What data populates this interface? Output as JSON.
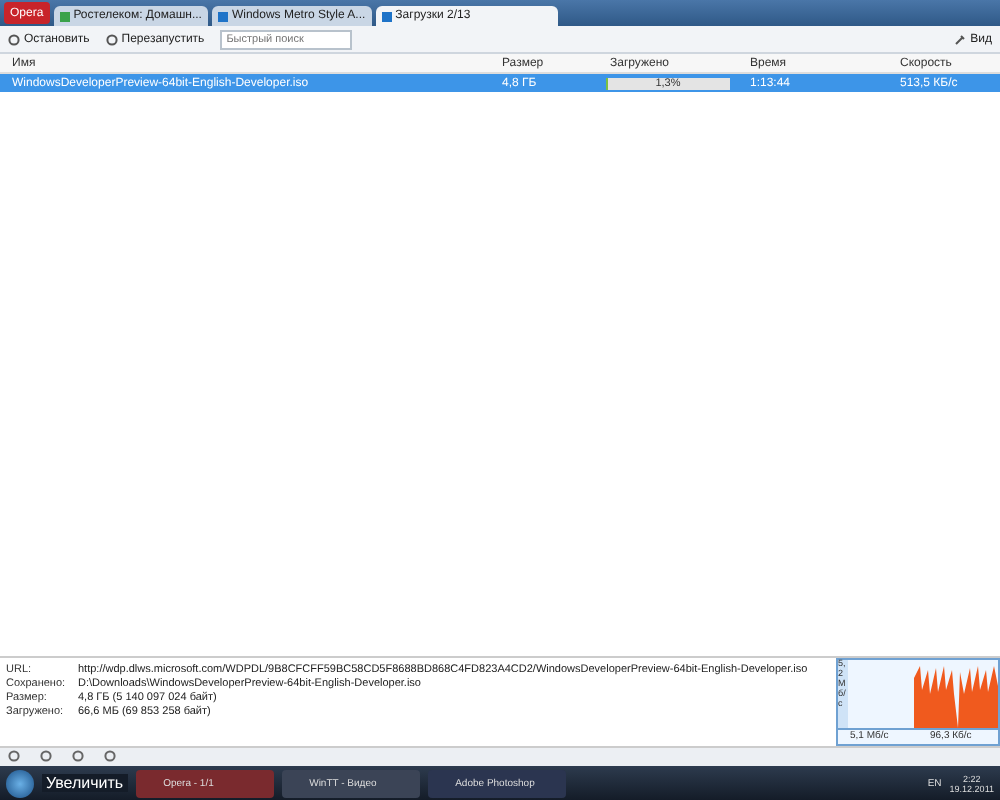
{
  "menu_button": {
    "label": "Opera"
  },
  "tabs": [
    {
      "label": "Ростелеком: Домашн...",
      "selected": false
    },
    {
      "label": "Windows Metro Style A...",
      "selected": false
    },
    {
      "label": "Загрузки 2/13",
      "selected": true
    }
  ],
  "toolbar": {
    "buttons": [
      "Остановить",
      "Перезапустить"
    ],
    "search": {
      "placeholder": "Быстрый поиск"
    },
    "view_button": "Вид"
  },
  "table": {
    "columns": [
      "Имя",
      "Размер",
      "Загружено",
      "Время",
      "Скорость"
    ],
    "rows": [
      {
        "name": "WindowsDeveloperPreview-64bit-English-Developer.iso",
        "size": "4,8 ГБ",
        "level": 0.013,
        "progress": "1,3%",
        "time": "1:13:44",
        "speed": "513,5 КБ/с",
        "selected": true
      }
    ]
  },
  "details": [
    {
      "label": "URL:",
      "value": "http://wdp.dlws.microsoft.com/WDPDL/9B8CFCFF59BC58CD5F8688BD868C4FD823A4CD2/WindowsDeveloperPreview-64bit-English-Developer.iso"
    },
    {
      "label": "Сохранено:",
      "value": "D:\\Downloads\\WindowsDeveloperPreview-64bit-English-Developer.iso"
    },
    {
      "label": "Размер:",
      "value": "4,8 ГБ (5 140 097 024 байт)"
    },
    {
      "label": "Загружено:",
      "value": "66,6 МБ (69 853 258 байт)"
    }
  ],
  "speed_graph": {
    "axis_label": "5,2 Мб/с",
    "down": "5,1 Мб/с",
    "up": "96,3 Кб/с"
  },
  "taskbar": {
    "tooltip": "Увеличить",
    "apps": [
      "Opera - 1/1",
      "WinTT - Видео",
      "Adobe Photoshop"
    ],
    "language": "EN",
    "time": "2:22",
    "date": "19.12.2011"
  }
}
